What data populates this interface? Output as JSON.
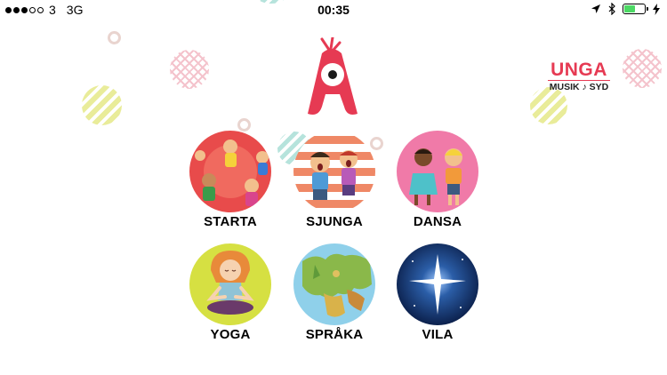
{
  "status_bar": {
    "carrier": "3",
    "network": "3G",
    "time": "00:35",
    "battery_level": 0.55,
    "signal_bars_filled": 3
  },
  "partner_logo": {
    "name": "UNGA",
    "subtitle": "MUSIK ♪ SYD"
  },
  "menu": [
    {
      "label": "STARTA",
      "icon": "children-circle-icon"
    },
    {
      "label": "SJUNGA",
      "icon": "singing-children-icon"
    },
    {
      "label": "DANSA",
      "icon": "dancing-children-icon"
    },
    {
      "label": "YOGA",
      "icon": "yoga-girl-icon"
    },
    {
      "label": "SPRÅKA",
      "icon": "europe-map-icon"
    },
    {
      "label": "VILA",
      "icon": "star-night-icon"
    }
  ],
  "colors": {
    "brand_red": "#e63a53",
    "battery_green": "#4cd964"
  }
}
